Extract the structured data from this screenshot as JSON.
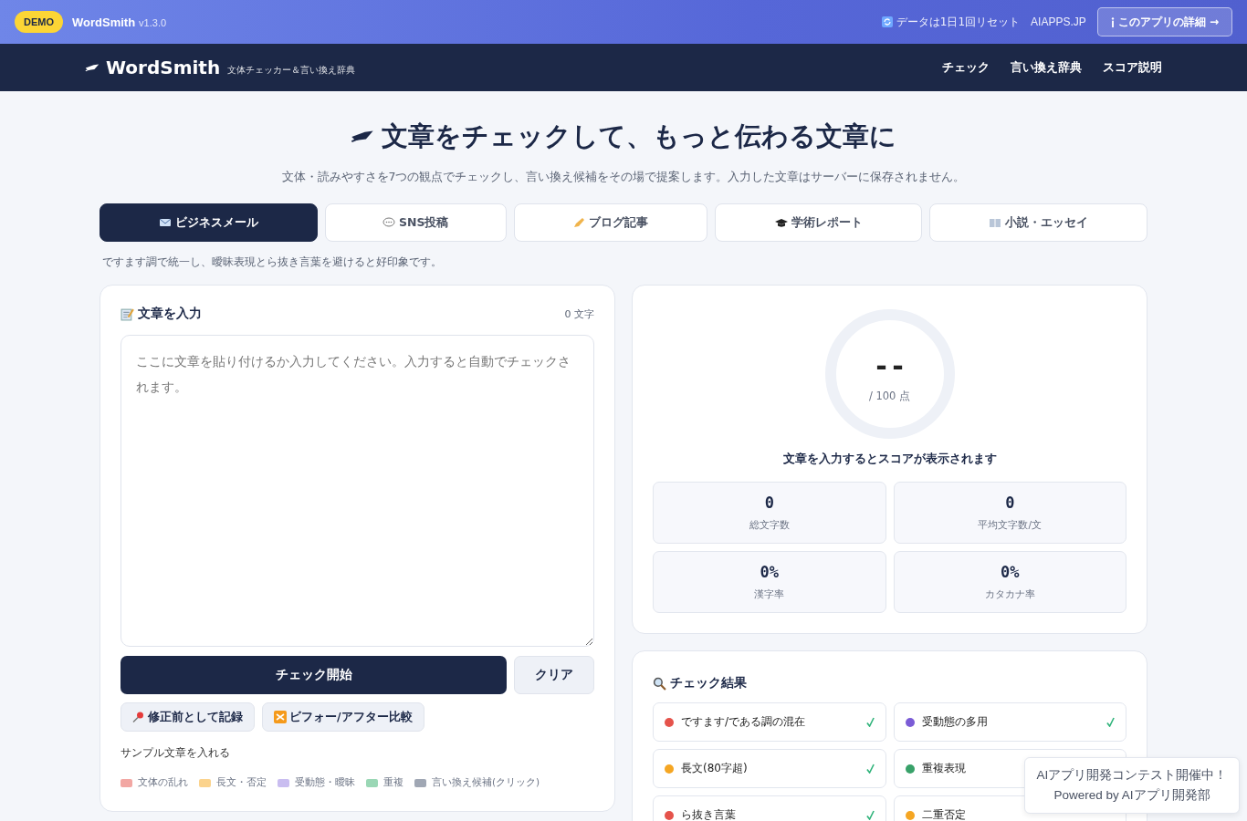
{
  "topbar": {
    "badge": "DEMO",
    "app_name": "WordSmith",
    "version": "v1.3.0",
    "reset_note": "データは1日1回リセット",
    "site_link": "AIAPPS.JP",
    "about_button": "このアプリの詳細 →"
  },
  "navbar": {
    "logo": "WordSmith",
    "tagline": "文体チェッカー＆言い換え辞典",
    "links": [
      {
        "label": "チェック"
      },
      {
        "label": "言い換え辞典"
      },
      {
        "label": "スコア説明"
      }
    ]
  },
  "hero": {
    "title": "文章をチェックして、もっと伝わる文章に",
    "subtitle": "文体・読みやすさを7つの観点でチェックし、言い換え候補をその場で提案します。入力した文章はサーバーに保存されません。"
  },
  "tabs": [
    {
      "label": "ビジネスメール",
      "selected": true
    },
    {
      "label": "SNS投稿",
      "selected": false
    },
    {
      "label": "ブログ記事",
      "selected": false
    },
    {
      "label": "学術レポート",
      "selected": false
    },
    {
      "label": "小説・エッセイ",
      "selected": false
    }
  ],
  "tab_hint": "ですます調で統一し、曖昧表現とら抜き言葉を避けると好印象です。",
  "editor": {
    "title": "文章を入力",
    "count": "0 文字",
    "placeholder": "ここに文章を貼り付けるか入力してください。入力すると自動でチェックされます。",
    "check_button": "チェック開始",
    "clear_button": "クリア",
    "record_button": "修正前として記録",
    "compare_button": "ビフォー/アフター比較",
    "sample_link": "サンプル文章を入れる",
    "legend": [
      {
        "label": "文体の乱れ",
        "color": "#f2a7a3"
      },
      {
        "label": "長文・否定",
        "color": "#fbd38d"
      },
      {
        "label": "受動態・曖昧",
        "color": "#c9bdf0"
      },
      {
        "label": "重複",
        "color": "#9ad7b5"
      },
      {
        "label": "言い換え候補(クリック)",
        "color": "#a0a7b4"
      }
    ]
  },
  "score": {
    "value": "--",
    "unit": "/ 100 点",
    "message": "文章を入力するとスコアが表示されます",
    "stats": [
      {
        "value": "0",
        "label": "総文字数"
      },
      {
        "value": "0",
        "label": "平均文字数/文"
      },
      {
        "value": "0%",
        "label": "漢字率"
      },
      {
        "value": "0%",
        "label": "カタカナ率"
      }
    ]
  },
  "results": {
    "title": "チェック結果",
    "items": [
      {
        "label": "ですます/である調の混在",
        "color": "#e5534b",
        "passed": true
      },
      {
        "label": "受動態の多用",
        "color": "#7b5cd6",
        "passed": true
      },
      {
        "label": "長文(80字超)",
        "color": "#f5a623",
        "passed": true
      },
      {
        "label": "重複表現",
        "color": "#38a169"
      },
      {
        "label": "ら抜き言葉",
        "color": "#e5534b",
        "passed": true
      },
      {
        "label": "二重否定",
        "color": "#f5a623"
      }
    ]
  },
  "toast": {
    "line_1": "AIアプリ開発コンテスト開催中！",
    "line_2": "Powered by AIアプリ開発部"
  }
}
